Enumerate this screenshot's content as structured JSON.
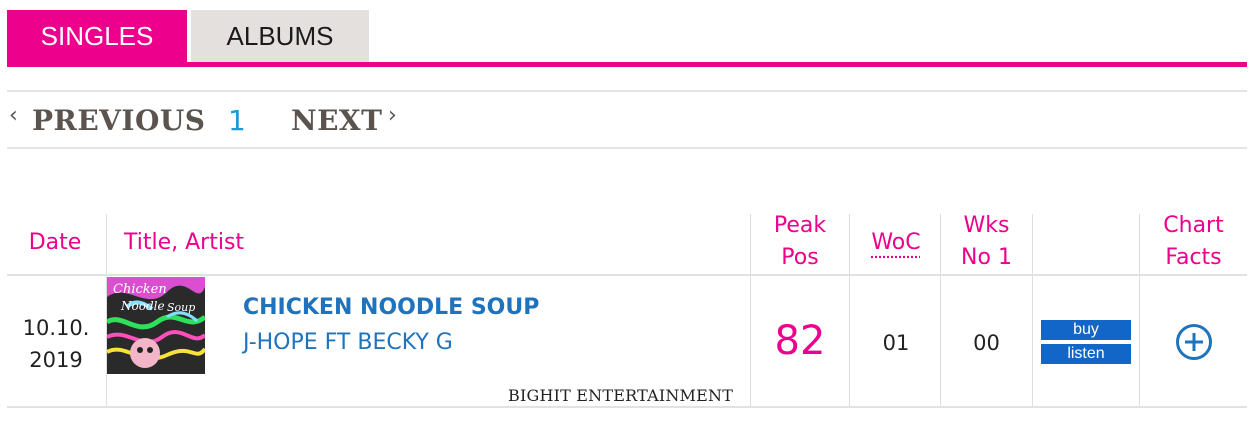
{
  "tabs": [
    {
      "label": "SINGLES",
      "active": true
    },
    {
      "label": "ALBUMS",
      "active": false
    }
  ],
  "pager": {
    "previous_label": "PREVIOUS",
    "page": "1",
    "next_label": "NEXT"
  },
  "icons": {
    "prev": "chevron-left-icon",
    "next": "chevron-right-icon",
    "chart_facts": "plus-circle-icon"
  },
  "table": {
    "headers": {
      "date": "Date",
      "title_artist": "Title, Artist",
      "peak_line1": "Peak",
      "peak_line2": "Pos",
      "woc": "WoC",
      "wks_line1": "Wks",
      "wks_line2": "No 1",
      "facts_line1": "Chart",
      "facts_line2": "Facts"
    },
    "rows": [
      {
        "date_line1": "10.10.",
        "date_line2": "2019",
        "cover_text_line1": "Chicken",
        "cover_text_line2": "Noodle",
        "cover_text_line3": "Soup",
        "title": "CHICKEN NOODLE SOUP",
        "artist": "J-HOPE FT BECKY G",
        "label": "BIGHIT ENTERTAINMENT",
        "peak_pos": "82",
        "woc": "01",
        "wks_no1": "00",
        "buy_label": "buy",
        "listen_label": "listen"
      }
    ]
  },
  "colors": {
    "accent": "#ec008c",
    "link_blue": "#1f73bd",
    "button_blue": "#1166c8",
    "tab_inactive": "#e3e0dd"
  }
}
